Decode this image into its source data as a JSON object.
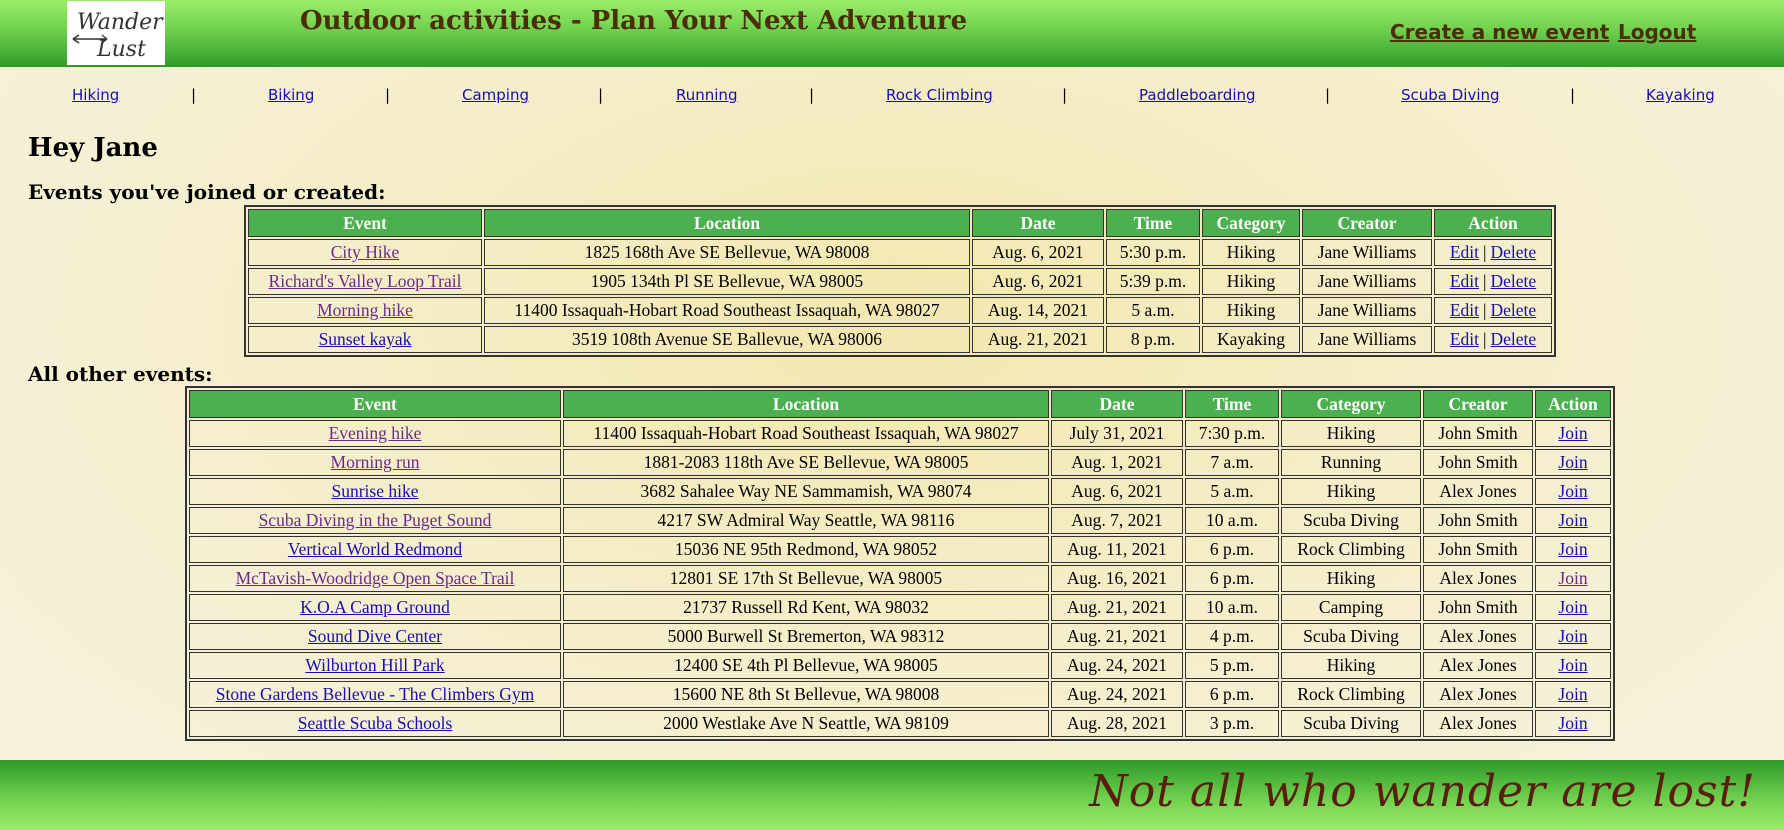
{
  "header": {
    "logo_text": "Wander Lust",
    "title": "Outdoor activities - Plan Your Next Adventure",
    "create_event": "Create a new event",
    "logout": "Logout"
  },
  "nav": {
    "items": [
      "Hiking",
      "Biking",
      "Camping",
      "Running",
      "Rock Climbing",
      "Paddleboarding",
      "Scuba Diving",
      "Kayaking"
    ],
    "separator": "|"
  },
  "greeting": "Hey Jane",
  "joined": {
    "heading": "Events you've joined or created:",
    "columns": [
      "Event",
      "Location",
      "Date",
      "Time",
      "Category",
      "Creator",
      "Action"
    ],
    "edit_label": "Edit",
    "delete_label": "Delete",
    "action_sep": "|",
    "rows": [
      {
        "event": "City Hike",
        "location": "1825 168th Ave SE Bellevue, WA 98008",
        "date": "Aug. 6, 2021",
        "time": "5:30 p.m.",
        "category": "Hiking",
        "creator": "Jane Williams"
      },
      {
        "event": "Richard's Valley Loop Trail",
        "location": "1905 134th Pl SE Bellevue, WA 98005",
        "date": "Aug. 6, 2021",
        "time": "5:39 p.m.",
        "category": "Hiking",
        "creator": "Jane Williams"
      },
      {
        "event": "Morning hike",
        "location": "11400 Issaquah-Hobart Road Southeast Issaquah, WA 98027",
        "date": "Aug. 14, 2021",
        "time": "5 a.m.",
        "category": "Hiking",
        "creator": "Jane Williams"
      },
      {
        "event": "Sunset kayak",
        "location": "3519 108th Avenue SE Ballevue, WA 98006",
        "date": "Aug. 21, 2021",
        "time": "8 p.m.",
        "category": "Kayaking",
        "creator": "Jane Williams"
      }
    ]
  },
  "others": {
    "heading": "All other events:",
    "columns": [
      "Event",
      "Location",
      "Date",
      "Time",
      "Category",
      "Creator",
      "Action"
    ],
    "join_label": "Join",
    "rows": [
      {
        "event": "Evening hike",
        "location": "11400 Issaquah-Hobart Road Southeast Issaquah, WA 98027",
        "date": "July 31, 2021",
        "time": "7:30 p.m.",
        "category": "Hiking",
        "creator": "John Smith"
      },
      {
        "event": "Morning run",
        "location": "1881-2083 118th Ave SE Bellevue, WA 98005",
        "date": "Aug. 1, 2021",
        "time": "7 a.m.",
        "category": "Running",
        "creator": "John Smith"
      },
      {
        "event": "Sunrise hike",
        "location": "3682 Sahalee Way NE Sammamish, WA 98074",
        "date": "Aug. 6, 2021",
        "time": "5 a.m.",
        "category": "Hiking",
        "creator": "Alex Jones"
      },
      {
        "event": "Scuba Diving in the Puget Sound",
        "location": "4217 SW Admiral Way Seattle, WA 98116",
        "date": "Aug. 7, 2021",
        "time": "10 a.m.",
        "category": "Scuba Diving",
        "creator": "John Smith"
      },
      {
        "event": "Vertical World Redmond",
        "location": "15036 NE 95th Redmond, WA 98052",
        "date": "Aug. 11, 2021",
        "time": "6 p.m.",
        "category": "Rock Climbing",
        "creator": "John Smith"
      },
      {
        "event": "McTavish-Woodridge Open Space Trail",
        "location": "12801 SE 17th St Bellevue, WA 98005",
        "date": "Aug. 16, 2021",
        "time": "6 p.m.",
        "category": "Hiking",
        "creator": "Alex Jones"
      },
      {
        "event": "K.O.A Camp Ground",
        "location": "21737 Russell Rd Kent, WA 98032",
        "date": "Aug. 21, 2021",
        "time": "10 a.m.",
        "category": "Camping",
        "creator": "John Smith"
      },
      {
        "event": "Sound Dive Center",
        "location": "5000 Burwell St Bremerton, WA 98312",
        "date": "Aug. 21, 2021",
        "time": "4 p.m.",
        "category": "Scuba Diving",
        "creator": "Alex Jones"
      },
      {
        "event": "Wilburton Hill Park",
        "location": "12400 SE 4th Pl Bellevue, WA 98005",
        "date": "Aug. 24, 2021",
        "time": "5 p.m.",
        "category": "Hiking",
        "creator": "Alex Jones"
      },
      {
        "event": "Stone Gardens Bellevue - The Climbers Gym",
        "location": "15600 NE 8th St Bellevue, WA 98008",
        "date": "Aug. 24, 2021",
        "time": "6 p.m.",
        "category": "Rock Climbing",
        "creator": "Alex Jones"
      },
      {
        "event": "Seattle Scuba Schools",
        "location": "2000 Westlake Ave N Seattle, WA 98109",
        "date": "Aug. 28, 2021",
        "time": "3 p.m.",
        "category": "Scuba Diving",
        "creator": "Alex Jones"
      }
    ]
  },
  "footer": {
    "motto": "Not all who wander are lost!"
  },
  "colors": {
    "header_green": "#6fd04e",
    "table_header": "#4caf50",
    "link": "#1a0dab",
    "visited_link": "#6a2a8a",
    "title_brown": "#4a2f05",
    "motto_brown": "#5a1e0e"
  }
}
